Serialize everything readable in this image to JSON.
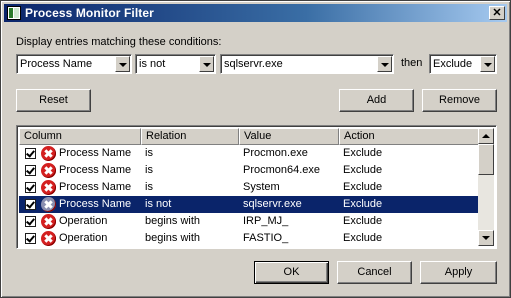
{
  "window": {
    "title": "Process Monitor Filter",
    "close_label": "✕"
  },
  "filter": {
    "prompt": "Display entries matching these conditions:",
    "column_value": "Process Name",
    "relation_value": "is not",
    "value_value": "sqlservr.exe",
    "then_label": "then",
    "action_value": "Exclude"
  },
  "buttons": {
    "reset": "Reset",
    "add": "Add",
    "remove": "Remove",
    "ok": "OK",
    "cancel": "Cancel",
    "apply": "Apply"
  },
  "list": {
    "columns": [
      "Column",
      "Relation",
      "Value",
      "Action"
    ],
    "rows": [
      {
        "column": "Process Name",
        "relation": "is",
        "value": "Procmon.exe",
        "action": "Exclude",
        "checked": true,
        "selected": false
      },
      {
        "column": "Process Name",
        "relation": "is",
        "value": "Procmon64.exe",
        "action": "Exclude",
        "checked": true,
        "selected": false
      },
      {
        "column": "Process Name",
        "relation": "is",
        "value": "System",
        "action": "Exclude",
        "checked": true,
        "selected": false
      },
      {
        "column": "Process Name",
        "relation": "is not",
        "value": "sqlservr.exe",
        "action": "Exclude",
        "checked": true,
        "selected": true
      },
      {
        "column": "Operation",
        "relation": "begins with",
        "value": "IRP_MJ_",
        "action": "Exclude",
        "checked": true,
        "selected": false
      },
      {
        "column": "Operation",
        "relation": "begins with",
        "value": "FASTIO_",
        "action": "Exclude",
        "checked": true,
        "selected": false
      }
    ]
  },
  "icons": {
    "row_icon": "exclude-x-icon",
    "checkbox": "checkbox-icon"
  },
  "colors": {
    "selection": "#0a246a",
    "title_gradient_start": "#0a246a",
    "exclude_icon": "#d42020"
  }
}
